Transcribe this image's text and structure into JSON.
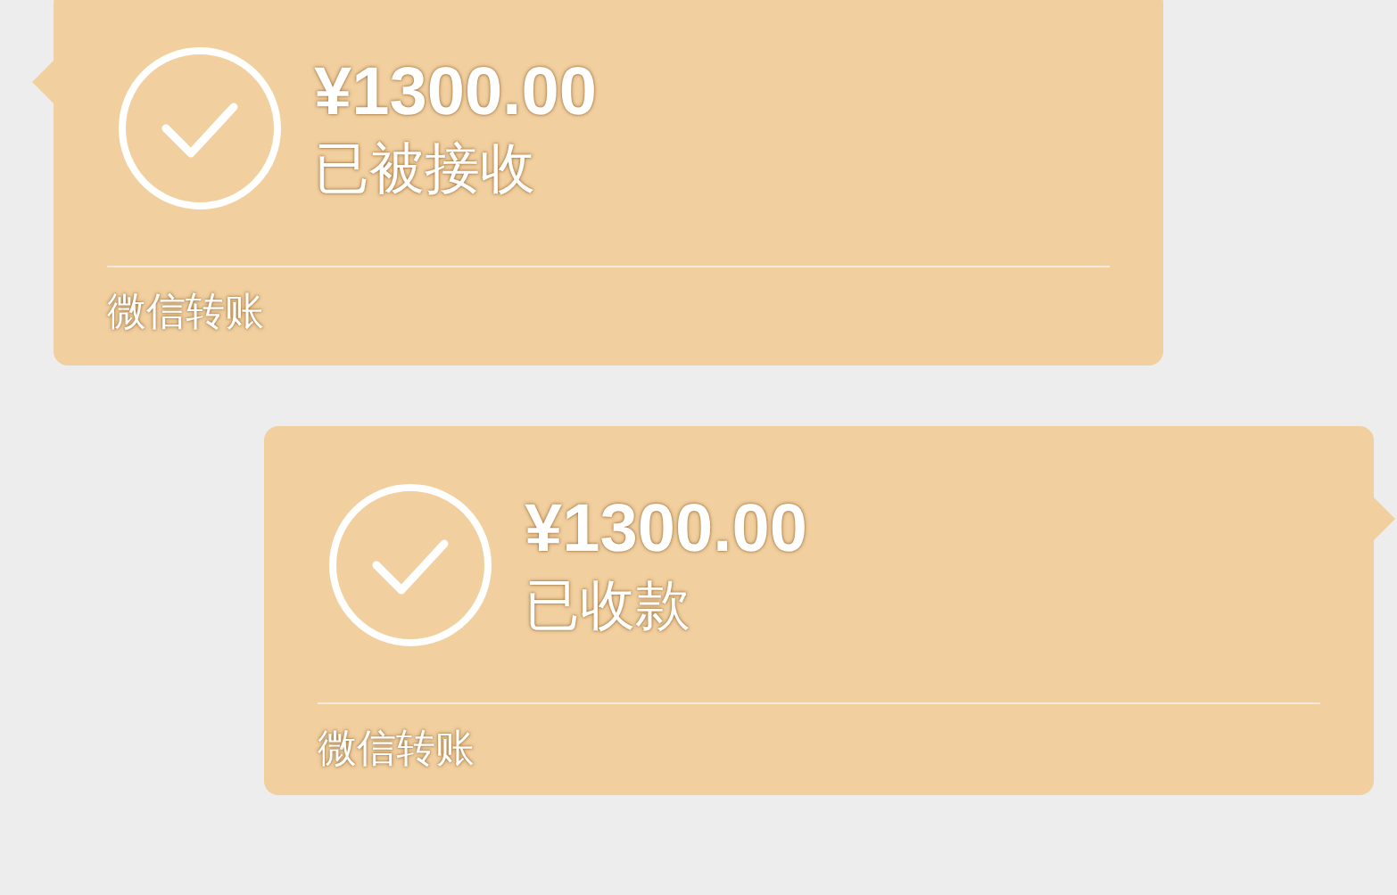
{
  "messages": [
    {
      "kind": "incoming",
      "amount": "¥1300.00",
      "status": "已被接收",
      "footer": "微信转账"
    },
    {
      "kind": "outgoing",
      "amount": "¥1300.00",
      "status": "已收款",
      "footer": "微信转账"
    }
  ]
}
